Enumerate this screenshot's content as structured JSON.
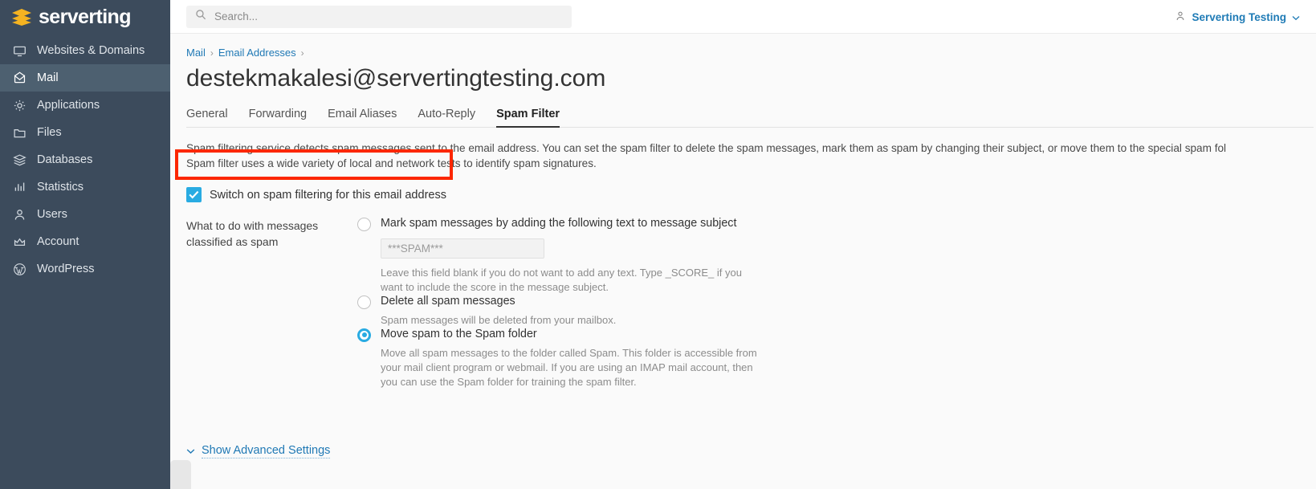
{
  "brand": {
    "name": "serverting",
    "logo_icon": "stacked-layers-icon"
  },
  "sidebar": {
    "items": [
      {
        "label": "Websites & Domains",
        "icon": "monitor-icon",
        "active": false
      },
      {
        "label": "Mail",
        "icon": "envelope-icon",
        "active": true
      },
      {
        "label": "Applications",
        "icon": "gear-icon",
        "active": false
      },
      {
        "label": "Files",
        "icon": "folder-icon",
        "active": false
      },
      {
        "label": "Databases",
        "icon": "database-stack-icon",
        "active": false
      },
      {
        "label": "Statistics",
        "icon": "bar-chart-icon",
        "active": false
      },
      {
        "label": "Users",
        "icon": "person-icon",
        "active": false
      },
      {
        "label": "Account",
        "icon": "crown-icon",
        "active": false
      },
      {
        "label": "WordPress",
        "icon": "wordpress-icon",
        "active": false
      }
    ]
  },
  "topbar": {
    "search_placeholder": "Search...",
    "search_value": "",
    "search_icon": "search-icon",
    "user_icon": "user-icon",
    "user_name": "Serverting Testing",
    "user_chevron_icon": "chevron-down-icon"
  },
  "breadcrumb": {
    "items": [
      "Mail",
      "Email Addresses"
    ],
    "separator": "›"
  },
  "page": {
    "title": "destekmakalesi@servertingtesting.com"
  },
  "tabs": [
    {
      "label": "General",
      "active": false
    },
    {
      "label": "Forwarding",
      "active": false
    },
    {
      "label": "Email Aliases",
      "active": false
    },
    {
      "label": "Auto-Reply",
      "active": false
    },
    {
      "label": "Spam Filter",
      "active": true
    }
  ],
  "spam_filter": {
    "description_line1": "Spam filtering service detects spam messages sent to the email address. You can set the spam filter to delete the spam messages, mark them as spam by changing their subject, or move them to the special spam fol",
    "description_line2": "Spam filter uses a wide variety of local and network tests to identify spam signatures.",
    "enable_checkbox_label": "Switch on spam filtering for this email address",
    "enable_checkbox_checked": true,
    "action_group_label": "What to do with messages classified as spam",
    "options": [
      {
        "label": "Mark spam messages by adding the following text to message subject",
        "selected": false,
        "input_placeholder": "***SPAM***",
        "input_value": "",
        "hint": "Leave this field blank if you do not want to add any text. Type _SCORE_ if you want to include the score in the message subject."
      },
      {
        "label": "Delete all spam messages",
        "selected": false,
        "hint": "Spam messages will be deleted from your mailbox."
      },
      {
        "label": "Move spam to the Spam folder",
        "selected": true,
        "hint": "Move all spam messages to the folder called Spam. This folder is accessible from your mail client program or webmail. If you are using an IMAP mail account, then you can use the Spam folder for training the spam filter."
      }
    ],
    "advanced_link_label": "Show Advanced Settings",
    "advanced_chevron_icon": "chevron-down-icon"
  },
  "annotation": {
    "highlight_color": "#fc2700",
    "target": "enable-spam-filtering-checkbox-row"
  },
  "colors": {
    "sidebar_bg": "#3c4b5c",
    "sidebar_active": "#4d6070",
    "accent_blue": "#29abe2",
    "link_blue": "#2079b5",
    "logo_gold": "#f5b321"
  }
}
